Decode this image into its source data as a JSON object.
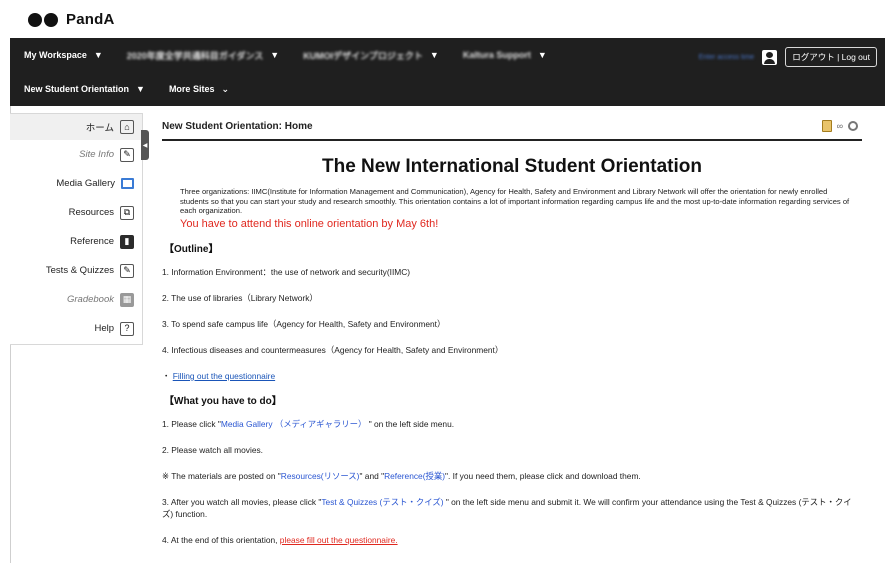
{
  "brand": {
    "name": "PandA"
  },
  "topnav": {
    "row1": [
      {
        "label": "My Workspace"
      },
      {
        "label": "2020年度全学共通科目ガイダンス"
      },
      {
        "label": "KUMOIデザインプロジェクト"
      },
      {
        "label": "Kaltura Support"
      }
    ],
    "row2": [
      {
        "label": "New Student Orientation"
      },
      {
        "label": "More Sites"
      }
    ],
    "access_link": "Enter access time",
    "logout_label": "ログアウト | Log out"
  },
  "sidebar": {
    "items": [
      {
        "label": "ホーム",
        "icon": "home-icon",
        "glyph": "⌂"
      },
      {
        "label": "Site Info",
        "icon": "site-info-icon",
        "glyph": "✎"
      },
      {
        "label": "Media Gallery",
        "icon": "media-gallery-icon",
        "glyph": ""
      },
      {
        "label": "Resources",
        "icon": "resources-icon",
        "glyph": "⧉"
      },
      {
        "label": "Reference",
        "icon": "reference-icon",
        "glyph": "▮"
      },
      {
        "label": "Tests & Quizzes",
        "icon": "tests-quizzes-icon",
        "glyph": "✎"
      },
      {
        "label": "Gradebook",
        "icon": "gradebook-icon",
        "glyph": "▦"
      },
      {
        "label": "Help",
        "icon": "help-icon",
        "glyph": "?"
      }
    ]
  },
  "main": {
    "tool_title": "New Student Orientation: Home",
    "heading": "The New International Student Orientation",
    "intro": "Three organizations: IIMC(Institute for Information Management and Communication), Agency for Health, Safety and Environment and Library Network will offer the orientation for newly enrolled students so that you can start your study and research smoothly. This orientation contains a lot of important information regarding campus life and the most up-to-date information regarding services of each organization.",
    "notice": "You have to attend this online orientation by May 6th!",
    "outline_heading": "【Outline】",
    "outline": [
      "1. Information Environment：the use of network and security(IIMC)",
      "2. The use of libraries（Library Network）",
      "3. To spend safe campus life（Agency for Health, Safety and Environment）",
      "4. Infectious diseases and countermeasures（Agency for Health, Safety and Environment）"
    ],
    "questionnaire_prefix": "・",
    "questionnaire_link": "Filling out the questionnaire",
    "todo_heading": "【What you have to do】",
    "todo": {
      "step1_a": "1. Please click \"",
      "step1_link": "Media Gallery （メディアギャラリー）",
      "step1_b": " \" on the left side menu.",
      "step2": "2. Please watch all movies.",
      "note_a": "※  The materials are posted on \"",
      "note_link1": "Resources(リソース)",
      "note_b": "\" and \"",
      "note_link2": "Reference(授業)",
      "note_c": "\". If you need them, please click and download them.",
      "step3_a": "3. After you watch all movies, please click \"",
      "step3_link": "Test & Quizzes (テスト・クイズ)",
      "step3_b": " \" on the left side menu and submit it. We will confirm your attendance using the Test & Quizzes (テスト・クイズ) function.",
      "step4_a": "4. At the end of this orientation, ",
      "step4_link": "please fill out the questionnaire."
    }
  }
}
